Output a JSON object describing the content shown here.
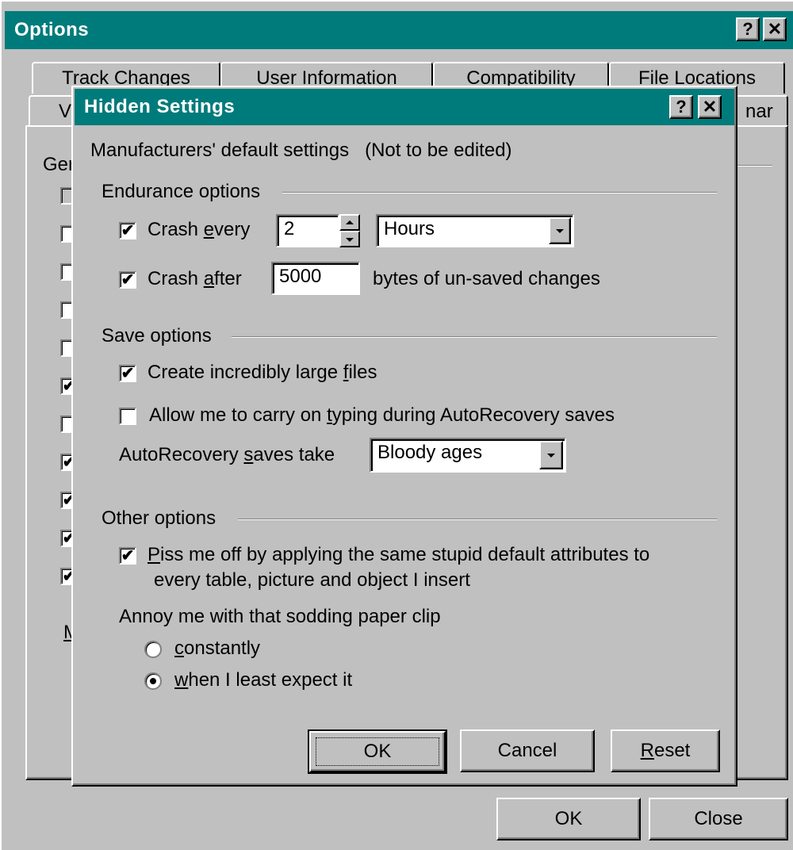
{
  "options_dialog": {
    "title": "Options",
    "help_glyph": "?",
    "close_glyph": "✕",
    "tabs_row1": [
      "Track Changes",
      "User Information",
      "Compatibility",
      "File Locations"
    ],
    "tabs_row2_left": "V",
    "tabs_row2_right": "nar",
    "group_label_partial": "Ger",
    "side_label_partial": "M",
    "ok_label": "OK",
    "close_label": "Close"
  },
  "hidden_dialog": {
    "title": "Hidden Settings",
    "help_glyph": "?",
    "close_glyph": "✕",
    "subtitle": "Manufacturers' default settings   (Not to be edited)",
    "endurance": {
      "heading": "Endurance options",
      "crash_every_label_pre": "Crash ",
      "crash_every_label_u": "e",
      "crash_every_label_post": "very",
      "crash_every_checked": true,
      "crash_every_value": "2",
      "crash_every_unit": "Hours",
      "crash_after_label_pre": "Crash ",
      "crash_after_label_u": "a",
      "crash_after_label_post": "fter",
      "crash_after_checked": true,
      "crash_after_value": "5000",
      "crash_after_suffix": "bytes of un-saved changes"
    },
    "save": {
      "heading": "Save options",
      "large_files_pre": "Create incredibly large ",
      "large_files_u": "f",
      "large_files_post": "iles",
      "large_files_checked": true,
      "typing_pre": "Allow me to carry on ",
      "typing_u": "t",
      "typing_post": "yping during AutoRecovery saves",
      "typing_checked": false,
      "autorecovery_pre": "AutoRecovery ",
      "autorecovery_u": "s",
      "autorecovery_post": "aves take",
      "autorecovery_value": "Bloody ages"
    },
    "other": {
      "heading": "Other options",
      "piss_u": "P",
      "piss_line1": "iss me off by applying the same stupid default attributes to",
      "piss_line2": "every table, picture and object I insert",
      "piss_checked": true,
      "paperclip_label": "Annoy me with that sodding paper clip",
      "radio1_u": "c",
      "radio1_post": "onstantly",
      "radio2_u": "w",
      "radio2_post": "hen I least expect it",
      "selected": "when I least expect it"
    },
    "ok_label": "OK",
    "cancel_label": "Cancel",
    "reset_u": "R",
    "reset_post": "eset"
  },
  "colors": {
    "titlebar": "#007b7b",
    "face": "#c0c0c0"
  }
}
